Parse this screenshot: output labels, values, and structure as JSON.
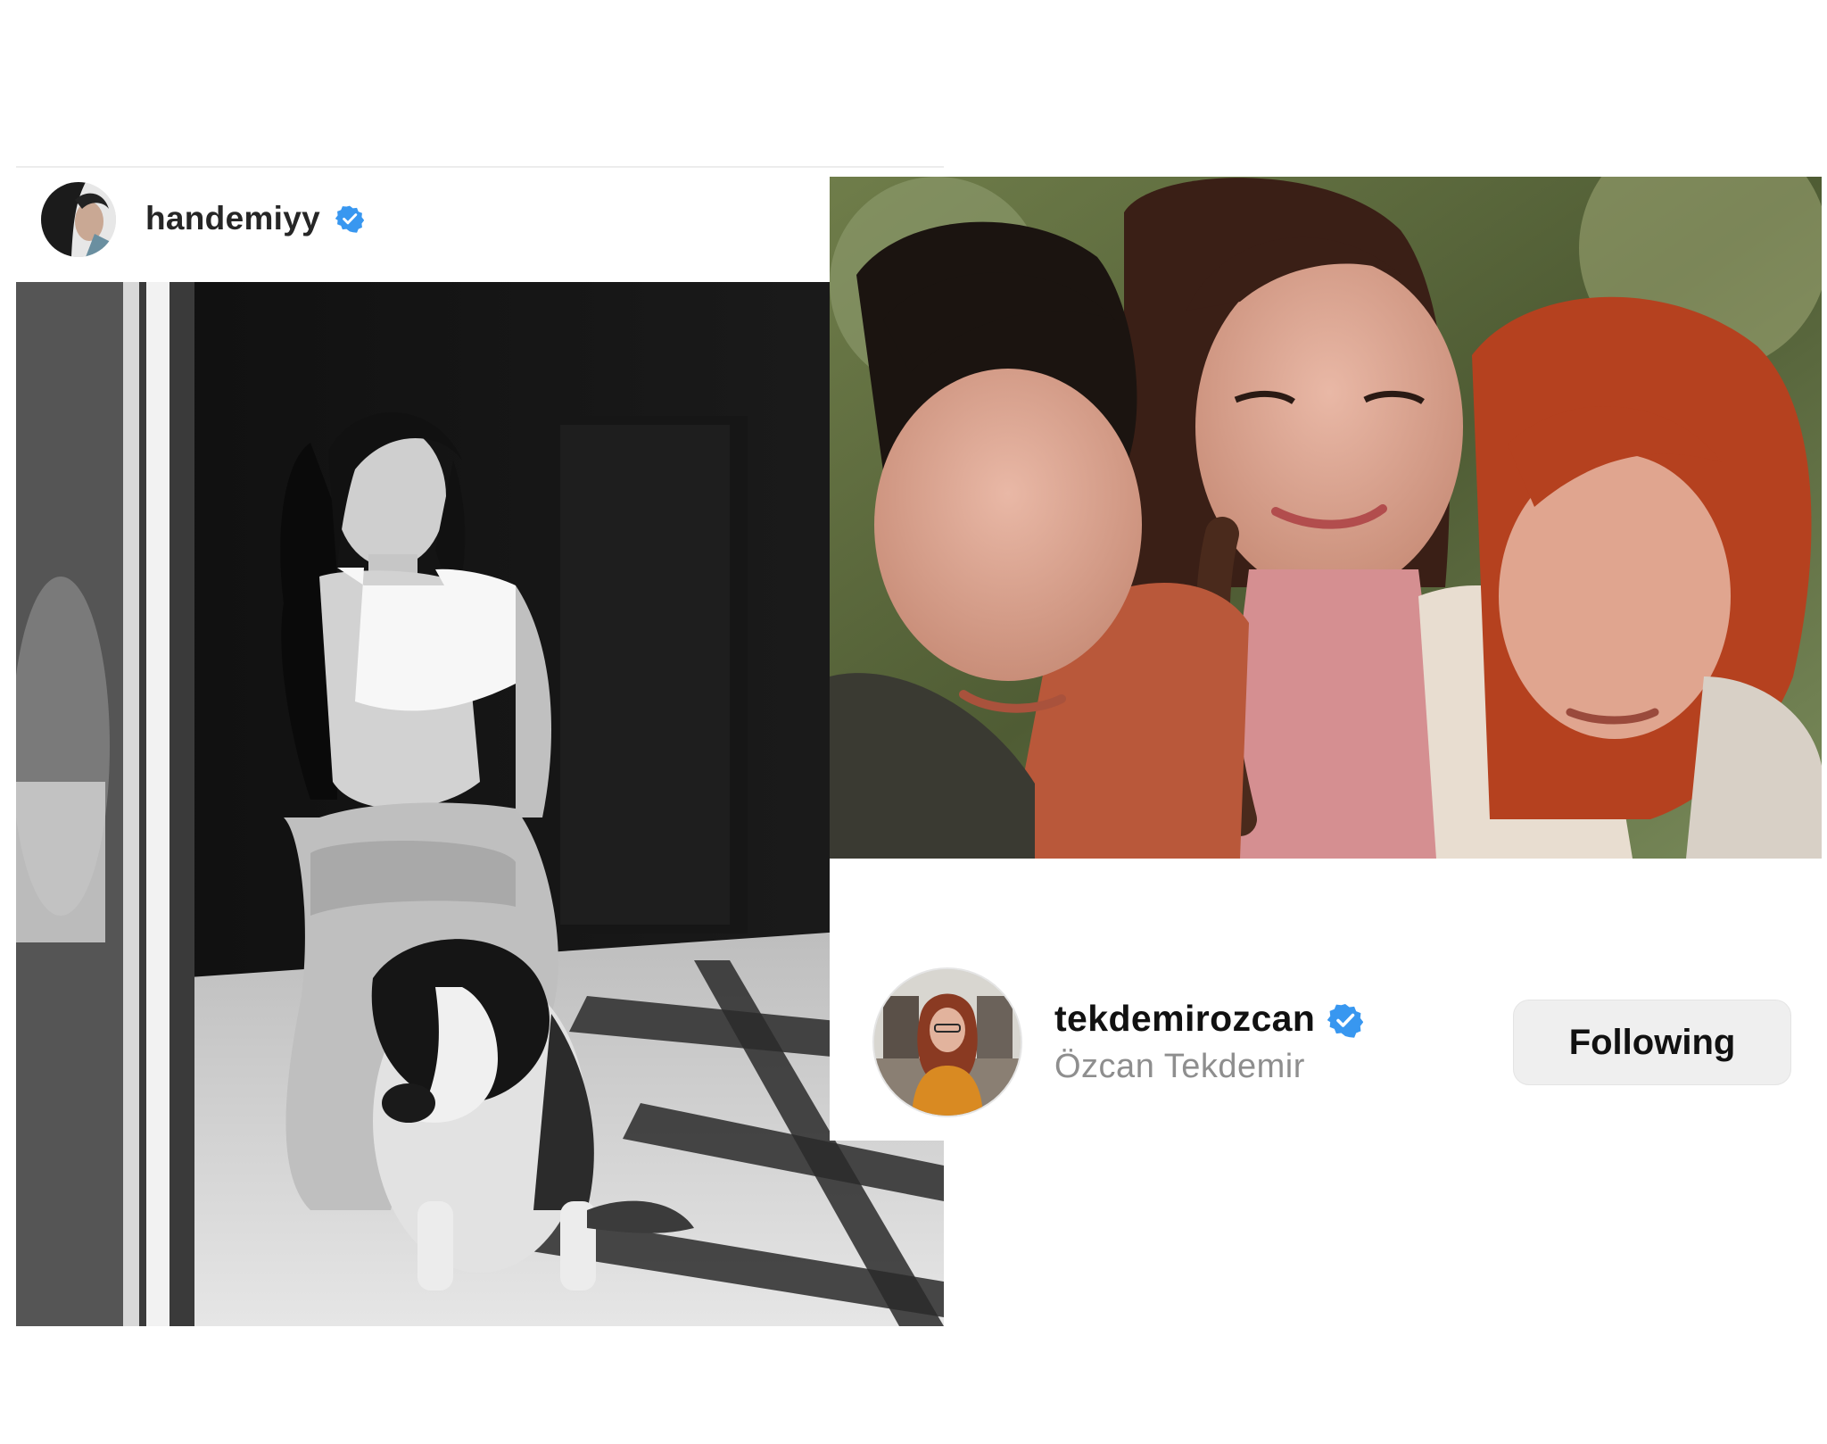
{
  "left_post": {
    "username": "handemiyy",
    "verified": true,
    "avatar_icon": "profile-avatar",
    "photo_desc_icon": "photo"
  },
  "right_post": {
    "username": "tekdemirozcan",
    "full_name": "Özcan Tekdemir",
    "verified": true,
    "follow_button_label": "Following"
  },
  "colors": {
    "verified_blue": "#3897f0",
    "username_text": "#262626",
    "secondary_text": "#8e8e8e",
    "button_bg": "#efefef"
  }
}
